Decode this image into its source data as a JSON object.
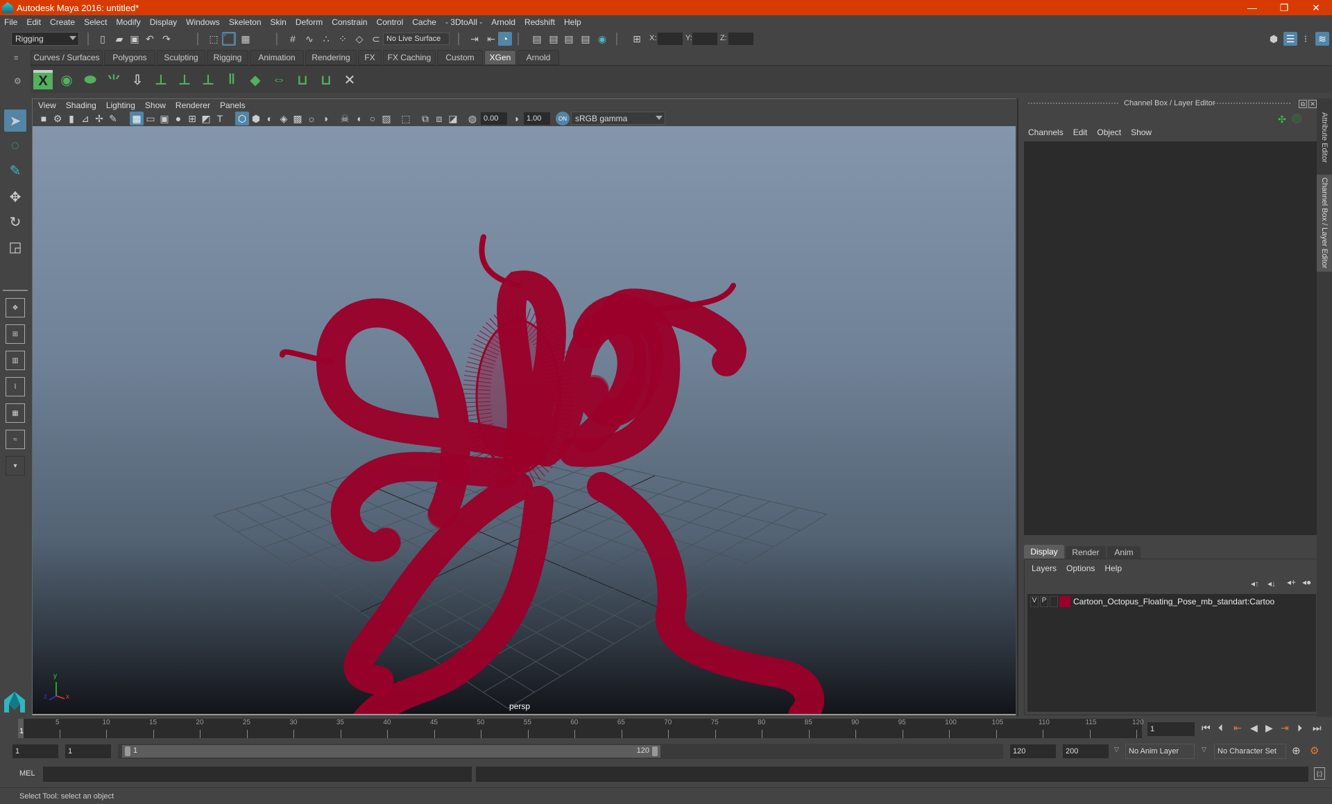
{
  "window": {
    "title": "Autodesk Maya 2016: untitled*",
    "controls": {
      "minimize": "—",
      "restore": "❐",
      "close": "✕"
    }
  },
  "menubar": [
    "File",
    "Edit",
    "Create",
    "Select",
    "Modify",
    "Display",
    "Windows",
    "Skeleton",
    "Skin",
    "Deform",
    "Constrain",
    "Control",
    "Cache",
    "- 3DtoAll -",
    "Arnold",
    "Redshift",
    "Help"
  ],
  "statusline": {
    "menuset": "Rigging",
    "live_surface": "No Live Surface",
    "coord_labels": {
      "x": "X:",
      "y": "Y:",
      "z": "Z:"
    },
    "coord_values": {
      "x": "",
      "y": "",
      "z": ""
    }
  },
  "shelf": {
    "tabs": [
      "Curves / Surfaces",
      "Polygons",
      "Sculpting",
      "Rigging",
      "Animation",
      "Rendering",
      "FX",
      "FX Caching",
      "Custom",
      "XGen",
      "Arnold"
    ],
    "active_tab": "XGen",
    "icons": [
      "xgen-window-icon",
      "xgen-preview-icon",
      "xgen-clear-preview-icon",
      "add-guides-icon",
      "place-guides-icon",
      "add-guide-icon",
      "guide-visibility-icon",
      "lock-guides-icon",
      "split-guides-icon",
      "guide-grid-icon",
      "flip-guides-icon",
      "select-guides-icon",
      "guide-bounds-icon",
      "delete-guides-icon"
    ]
  },
  "viewport": {
    "menu": [
      "View",
      "Shading",
      "Lighting",
      "Show",
      "Renderer",
      "Panels"
    ],
    "exposure": "0.00",
    "gamma": "1.00",
    "color_management": "sRGB gamma",
    "camera_label": "persp",
    "axis_labels": {
      "x": "x",
      "y": "y",
      "z": "z"
    },
    "wireframe_color": "#9a0029"
  },
  "channel_box": {
    "title": "Channel Box / Layer Editor",
    "menu": [
      "Channels",
      "Edit",
      "Object",
      "Show"
    ]
  },
  "layer_editor": {
    "tabs": [
      "Display",
      "Render",
      "Anim"
    ],
    "active_tab": "Display",
    "menu": [
      "Layers",
      "Options",
      "Help"
    ],
    "layers": [
      {
        "visible": "V",
        "playback": "P",
        "color": "#9a0029",
        "name": "Cartoon_Octopus_Floating_Pose_mb_standart:Cartoon_("
      }
    ]
  },
  "side_tabs": [
    "Attribute Editor",
    "Channel Box / Layer Editor"
  ],
  "timeline": {
    "ticks": [
      5,
      10,
      15,
      20,
      25,
      30,
      35,
      40,
      45,
      50,
      55,
      60,
      65,
      70,
      75,
      80,
      85,
      90,
      95,
      100,
      105,
      110,
      115,
      120
    ],
    "range_start": 1,
    "range_end": 120,
    "current_frame_label": "1",
    "current_frame": "1"
  },
  "range_slider": {
    "start_time": "1",
    "playback_start": "1",
    "slider_start_label": "1",
    "slider_end_label": "120",
    "playback_end": "120",
    "end_time": "200",
    "anim_layer": "No Anim Layer",
    "character_set": "No Character Set"
  },
  "command_line": {
    "label": "MEL",
    "input": "",
    "result": ""
  },
  "help_line": "Select Tool: select an object"
}
